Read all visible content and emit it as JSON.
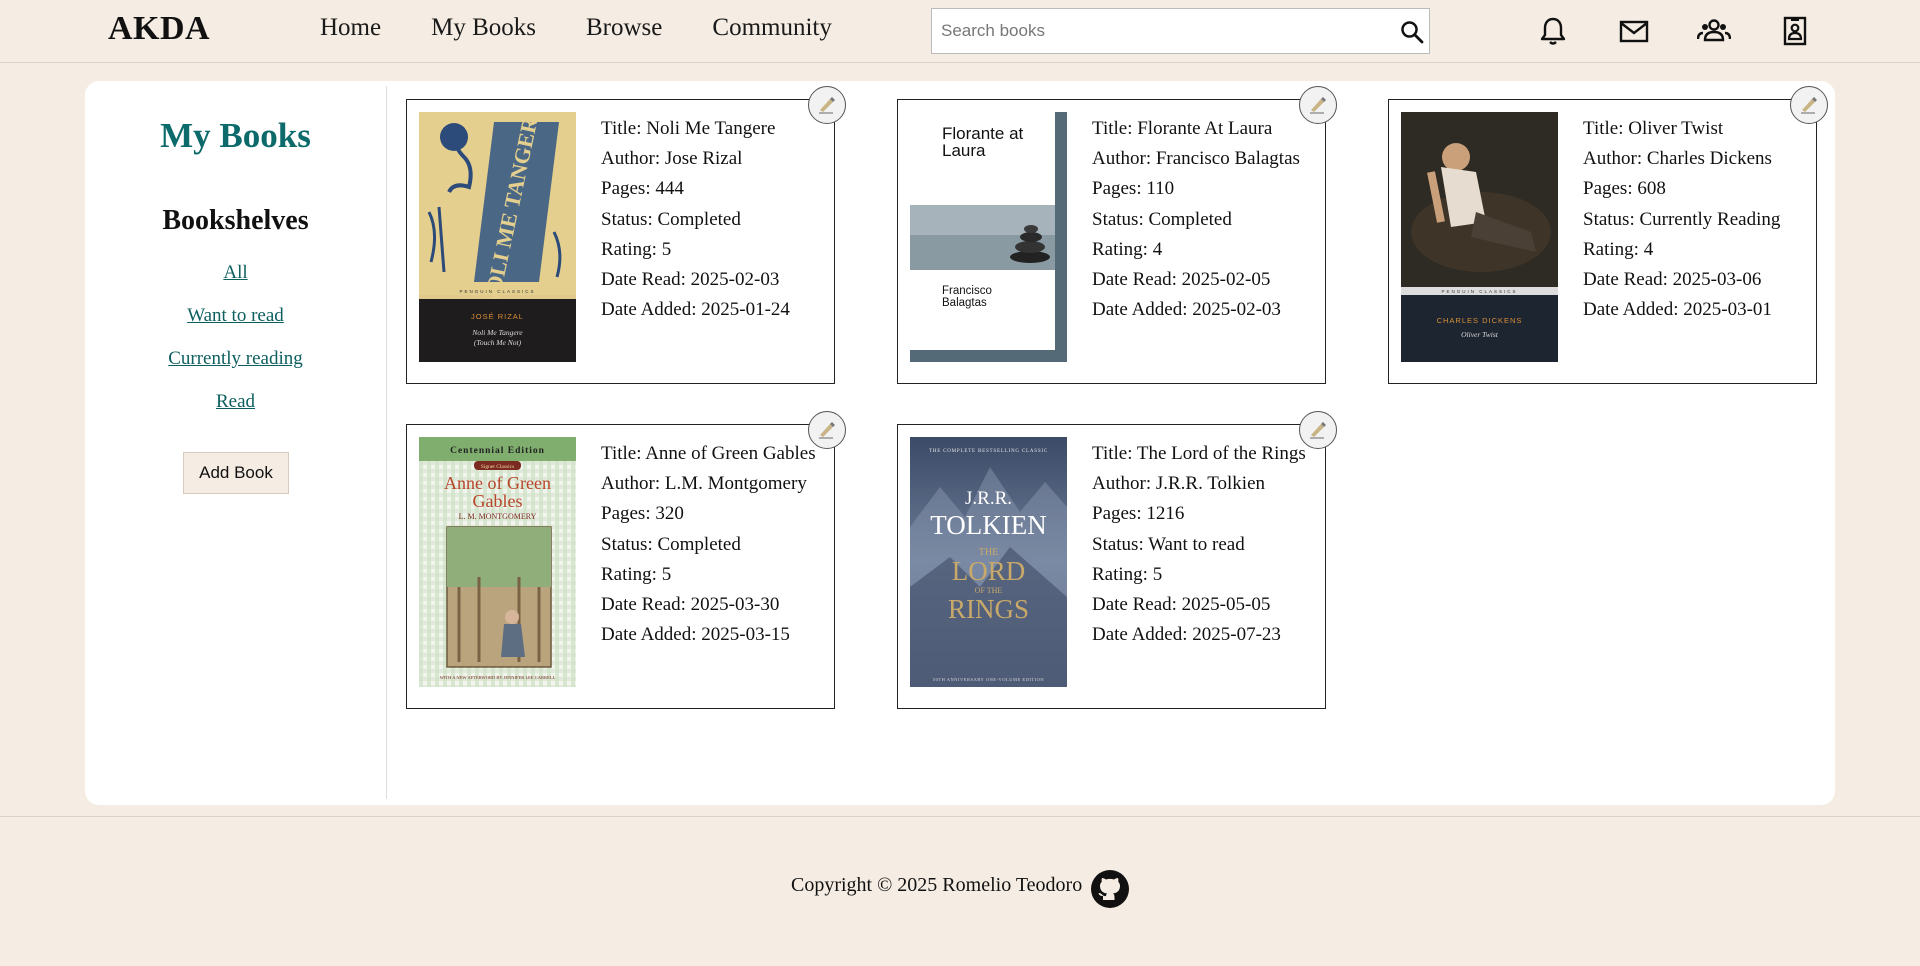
{
  "header": {
    "logo": "AKDA",
    "nav": [
      "Home",
      "My Books",
      "Browse",
      "Community"
    ],
    "search_placeholder": "Search books"
  },
  "sidebar": {
    "title": "My Books",
    "subtitle": "Bookshelves",
    "links": [
      "All",
      "Want to read",
      "Currently reading",
      "Read"
    ],
    "add_button": "Add Book"
  },
  "books": [
    {
      "title": "Title: Noli Me Tangere",
      "author": "Author: Jose Rizal",
      "pages": "Pages: 444",
      "status": "Status: Completed",
      "rating": "Rating: 5",
      "date_read": "Date Read: 2025-02-03",
      "date_added": "Date Added: 2025-01-24",
      "cover": {
        "main": "NOLI ME TANGERE",
        "line1": "JOSÉ RIZAL",
        "line2": "Noli Me Tangere",
        "line3": "(Touch Me Not)",
        "series": "PENGUIN CLASSICS"
      }
    },
    {
      "title": "Title: Florante At Laura",
      "author": "Author: Francisco Balagtas",
      "pages": "Pages: 110",
      "status": "Status: Completed",
      "rating": "Rating: 4",
      "date_read": "Date Read: 2025-02-05",
      "date_added": "Date Added: 2025-02-03",
      "cover": {
        "main": "Florante at Laura",
        "line1": "Francisco",
        "line2": "Balagtas"
      }
    },
    {
      "title": "Title: Oliver Twist",
      "author": "Author: Charles Dickens",
      "pages": "Pages: 608",
      "status": "Status: Currently Reading",
      "rating": "Rating: 4",
      "date_read": "Date Read: 2025-03-06",
      "date_added": "Date Added: 2025-03-01",
      "cover": {
        "line1": "CHARLES DICKENS",
        "line2": "Oliver Twist",
        "series": "PENGUIN CLASSICS"
      }
    },
    {
      "title": "Title: Anne of Green Gables",
      "author": "Author: L.M. Montgomery",
      "pages": "Pages: 320",
      "status": "Status: Completed",
      "rating": "Rating: 5",
      "date_read": "Date Read: 2025-03-30",
      "date_added": "Date Added: 2025-03-15",
      "cover": {
        "top": "Centennial Edition",
        "badge": "Signet Classics",
        "main": "Anne of Green Gables",
        "line1": "L. M. MONTGOMERY",
        "line2": "WITH A NEW AFTERWORD BY JENNIFER LEE CARRELL"
      }
    },
    {
      "title": "Title: The Lord of the Rings",
      "author": "Author: J.R.R. Tolkien",
      "pages": "Pages: 1216",
      "status": "Status: Want to read",
      "rating": "Rating: 5",
      "date_read": "Date Read: 2025-05-05",
      "date_added": "Date Added: 2025-07-23",
      "cover": {
        "top": "THE COMPLETE BESTSELLING CLASSIC",
        "line1": "J.R.R.",
        "line2": "TOLKIEN",
        "main1": "THE",
        "main2": "LORD",
        "main3": "OF THE",
        "main4": "RINGS",
        "bottom": "50TH ANNIVERSARY ONE-VOLUME EDITION"
      }
    }
  ],
  "footer": {
    "copyright": "Copyright © 2025 Romelio Teodoro"
  },
  "icons": [
    "search-icon",
    "bell-icon",
    "mail-icon",
    "people-icon",
    "contact-card-icon",
    "edit-icon",
    "github-icon"
  ],
  "colors": {
    "background": "#f5ede3",
    "accent": "#0d6a6a",
    "panel": "#ffffff"
  }
}
